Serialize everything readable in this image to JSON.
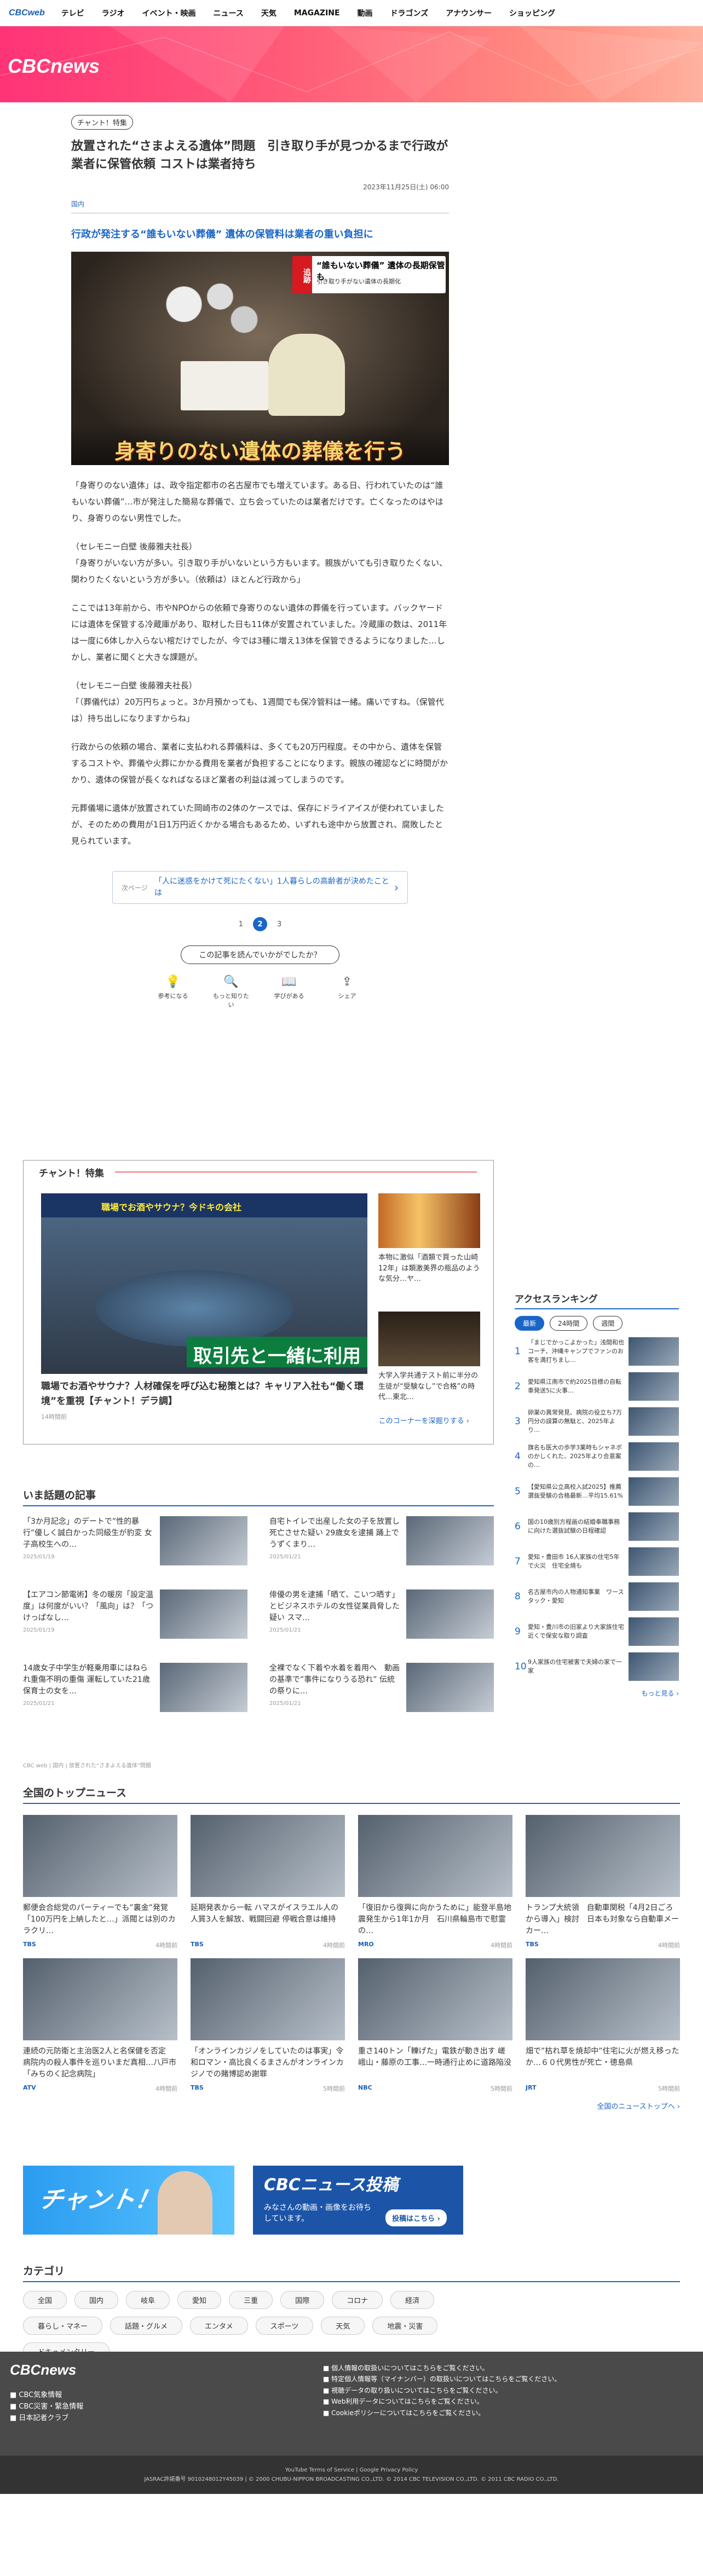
{
  "gnav": {
    "logo": "CBCweb",
    "items": [
      "テレビ",
      "ラジオ",
      "イベント・映画",
      "ニュース",
      "天気",
      "MAGAZINE",
      "動画",
      "ドラゴンズ",
      "アナウンサー",
      "ショッピング"
    ]
  },
  "hero": {
    "brand": "CBCnews"
  },
  "article": {
    "badge": "チャント！特集",
    "title": "放置された“さまよえる遺体”問題　引き取り手が見つかるまで行政が業者に保管依頼 コストは業者持ち",
    "date": "2023年11月25日(土) 06:00",
    "section": "国内",
    "headline": "行政が発注する“誰もいない葬儀” 遺体の保管料は業者の重い負担に",
    "photo": {
      "tag": "追跡",
      "line1": "“誰もいない葬儀” 遺体の長期保管も",
      "line2": "引き取り手がない遺体の長期化",
      "caption": "身寄りのない遺体の葬儀を行う"
    },
    "paragraphs": [
      "「身寄りのない遺体」は、政令指定都市の名古屋市でも増えています。ある日、行われていたのは“誰もいない葬儀”…市が発注した簡易な葬儀で、立ち会っていたのは業者だけです。亡くなったのはやはり、身寄りのない男性でした。",
      "（セレモニー白壁 後藤雅夫社長）\n「身寄りがいない方が多い。引き取り手がいないという方もいます。親族がいても引き取りたくない、関わりたくないという方が多い。（依頼は）ほとんど行政から」",
      "ここでは13年前から、市やNPOからの依頼で身寄りのない遺体の葬儀を行っています。バックヤードには遺体を保管する冷蔵庫があり、取材した日も11体が安置されていました。冷蔵庫の数は、2011年は一度に6体しか入らない棺だけでしたが、今では3種に増え13体を保管できるようになりました…しかし、業者に聞くと大きな課題が。",
      "（セレモニー白壁 後藤雅夫社長）\n「（葬儀代は）20万円ちょっと。3か月預かっても、1週間でも保冷管料は一緒。痛いですね。（保管代は）持ち出しになりますからね」",
      "行政からの依頼の場合、業者に支払われる葬儀料は、多くても20万円程度。その中から、遺体を保管するコストや、葬儀や火葬にかかる費用を業者が負担することになります。親族の確認などに時間がかかり、遺体の保管が長くなればなるほど業者の利益は減ってしまうのです。",
      "元葬儀場に遺体が放置されていた岡崎市の2体のケースでは、保存にドライアイスが使われていましたが、そのための費用が1日1万円近くかかる場合もあるため、いずれも途中から放置され、腐敗したと見られています。"
    ],
    "related": {
      "label": "次ページ",
      "text": "「人に迷惑をかけて死にたくない」1人暮らしの高齢者が決めたことは"
    },
    "pager": {
      "p1": "1",
      "p2": "2",
      "p3": "3"
    },
    "helpful": "この記事を読んでいかがでしたか？",
    "reactions": [
      "参考になる",
      "もっと知りたい",
      "学びがある",
      "シェア"
    ]
  },
  "feature": {
    "header": "チャント！特集",
    "bar": "職場でお酒やサウナ？今ドキの会社",
    "band": "取引先と一緒に利用",
    "title": "職場でお酒やサウナ？人材確保を呼び込む秘策とは？キャリア入社も“働く環境”を重視【チャント！デラ調】",
    "time": "14時間前",
    "side1": "本物に激似「酒類で買った山崎12年」は類激美界の瓶品のような気分…ヤ…",
    "side2": "大学入学共通テスト前に半分の生徒が“受験なし”で合格”の時代…東北…",
    "more": "このコーナーを深掘りする ›"
  },
  "ranking": {
    "header": "アクセスランキング",
    "tabs": [
      "最新",
      "24時間",
      "週間"
    ],
    "items": [
      "「まじでかっこよかった」浅間和也コーチ、沖縄キャンプでファンのお客を満打ちまし…",
      "愛知県江南市で約2025目標の自転車発送5に火事…",
      "卵巣の異常発見、病院の役立ち7万円分の誤算の無駄と、2025年より…",
      "旗名も医大の歩学3業時もシャネボのかしくれた、2025年より合意案の…",
      "【愛知県公立高校入試2025】推薦選抜受験の合格最新…平均15.61%",
      "国の10歳別方程画の結婚奉職事務に向けた選抜試験の日程確認",
      "愛知・豊田市 16人家族の住宅5年で火災　住宅全焼も",
      "名古屋市内の人物通知事業　ワースタック・愛知",
      "愛知・豊川市の旧家より大家族住宅近くで保安な取り調査",
      "9人家族の住宅被害で夫婦の家で一家"
    ],
    "more": "もっと見る ›"
  },
  "hot": {
    "header": "いま話題の記事",
    "items": [
      {
        "t": "「3か月記念」のデートで”性的暴行”優しく誠白かった同級生が豹変 女子高校生への…",
        "d": "2025/01/19"
      },
      {
        "t": "自宅トイレで出産した女の子を放置し死亡させた疑い 29歳女を逮捕 踊上でうずくまり…",
        "d": "2025/01/21"
      },
      {
        "t": "【エアコン節電術】冬の暖房「設定温度」は何度がいい？「風向」は？「つけっぱなし…",
        "d": "2025/01/19"
      },
      {
        "t": "俳優の男を逮捕「晒て、こいつ晒す」とビジネスホテルの女性従業員脅した疑い スマ…",
        "d": "2025/01/21"
      },
      {
        "t": "14歳女子中学生が軽乗用車にはねられ重傷不明の重傷 運転していた21歳保育士の女を…",
        "d": "2025/01/21"
      },
      {
        "t": "全裸でなく下着や水着を着用へ　動画の基準で”事件になりうる恐れ” 伝統の祭りに…",
        "d": "2025/01/21"
      }
    ]
  },
  "breadcrumb": "CBC web | 国内 | 放置された“さまよえる遺体”問題",
  "national": {
    "header": "全国のトップニュース",
    "items": [
      {
        "t": "郵便会合総党のパーティーでも”裏金”発覚「100万円を上納したと…」派閥とは別のカラクリ…",
        "s": "TBS",
        "m": "4時間前"
      },
      {
        "t": "延期発表から一転 ハマスがイスラエル人の人質3人を解放、戦闘回避 停戦合意は維持",
        "s": "TBS",
        "m": "4時間前"
      },
      {
        "t": "「復旧から復興に向かうために」能登半島地震発生から1年1か月　石川県輪島市で慰霊の…",
        "s": "MRO",
        "m": "4時間前"
      },
      {
        "t": "トランプ大統領　自動車関税「4月2日ごろから導入」検討　日本も対象なら自動車メーカー…",
        "s": "TBS",
        "m": "4時間前"
      },
      {
        "t": "連続の元防衛と主治医2人と名保健を否定　病院内の殺人事件を巡りいまだ真相…八戸市「みちのく記念病院」",
        "s": "ATV",
        "m": "4時間前"
      },
      {
        "t": "「オンラインカジノをしていたのは事実」令和ロマン・高比良くるまさんがオンラインカジノでの賭博認め謝罪",
        "s": "TBS",
        "m": "5時間前"
      },
      {
        "t": "重さ140トン「轢げた」電鉄が動き出す 嵯峨山・藤原の工事…一時通行止めに道路陥没",
        "s": "NBC",
        "m": "5時間前"
      },
      {
        "t": "畑で”枯れ草を焼却中”住宅に火が燃え移ったか…６０代男性が死亡・徳島県",
        "s": "JRT",
        "m": "5時間前"
      }
    ],
    "more": "全国のニューストップへ ›"
  },
  "banners": {
    "b1": "チャント！",
    "b2title": "CBCニュース投稿",
    "b2text": "みなさんの動画・画像をお待ちしています。",
    "b2cta": "投稿はこちら ›"
  },
  "category": {
    "header": "カテゴリ",
    "items": [
      "全国",
      "国内",
      "岐阜",
      "愛知",
      "三重",
      "国際",
      "コロナ",
      "経済",
      "暮らし・マネー",
      "話題・グルメ",
      "エンタメ",
      "スポーツ",
      "天気",
      "地震・災害",
      "ドキュメンタリー"
    ]
  },
  "footer": {
    "logo": "CBCnews",
    "links": [
      "■ CBC気象情報",
      "■ CBC災害・緊急情報",
      "■ 日本記者クラブ"
    ],
    "policy": "■ 個人情報の取扱いについてはこちらをご覧ください。\n■ 特定個人情報等（マイナンバー）の取扱いについてはこちらをご覧ください。\n■ 視聴データの取り扱いについてはこちらをご覧ください。\n■ Web利用データについてはこちらをご覧ください。\n■ Cookieポリシーについてはこちらをご覧ください。",
    "copy1": "YouTube Terms of Service | Google Privacy Policy",
    "copy2": "JASRAC許諾番号 9010248012Y45039 | © 2000 CHUBU-NIPPON BROADCASTING CO.,LTD. © 2014 CBC TELEVISION CO.,LTD. © 2011 CBC RADIO CO.,LTD."
  }
}
